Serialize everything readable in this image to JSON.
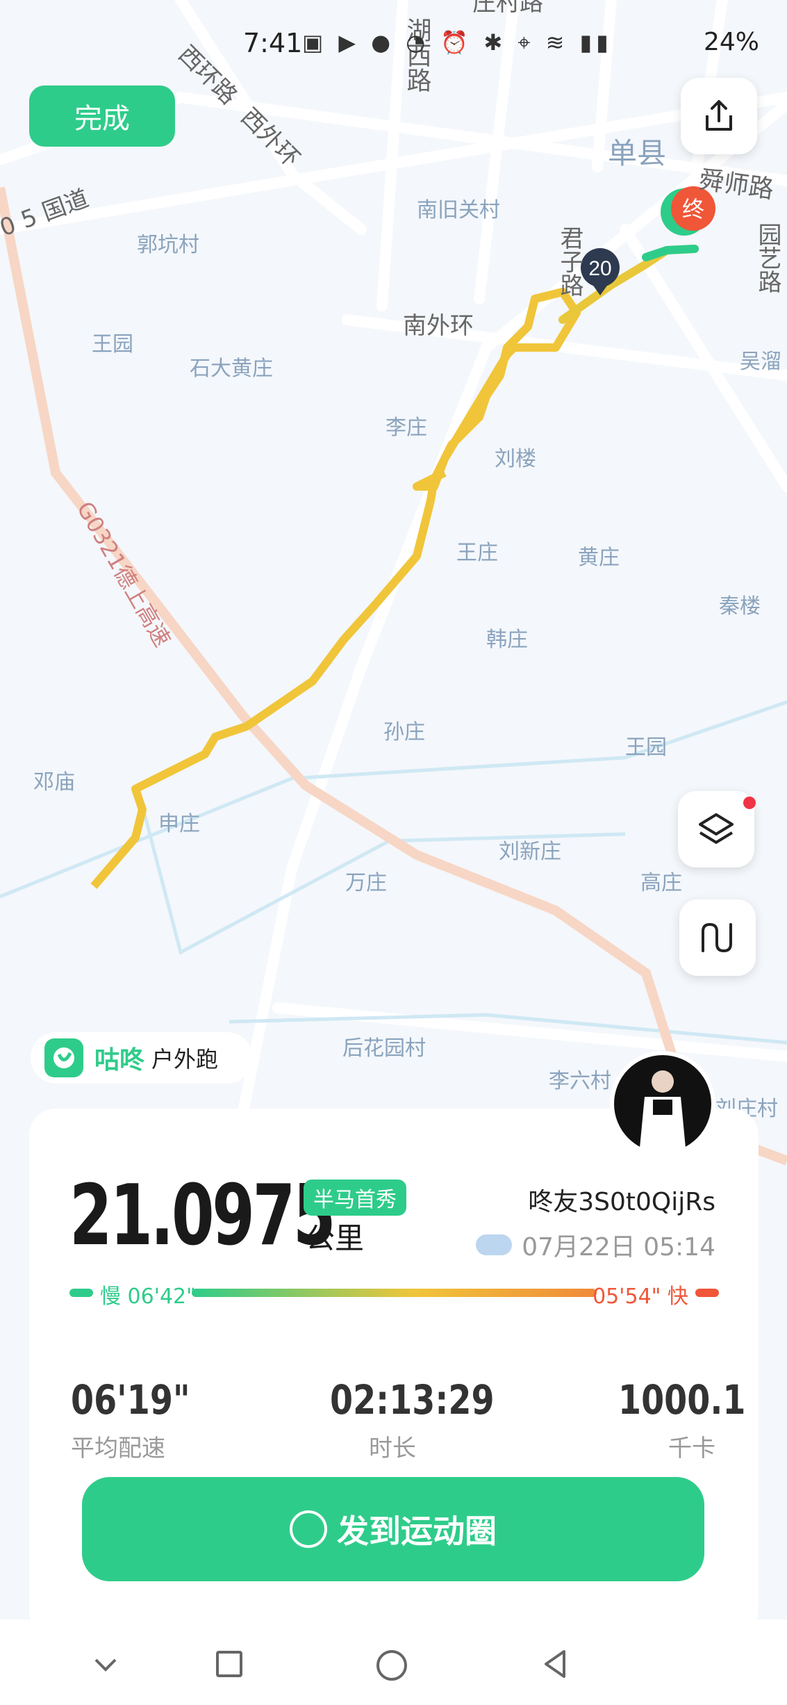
{
  "status_bar": {
    "time": "7:41",
    "battery": "24%"
  },
  "map": {
    "labels": [
      {
        "id": "xihuan-lu",
        "text": "西环路"
      },
      {
        "id": "xiwaihuan",
        "text": "西外环"
      },
      {
        "id": "hu-xi-lu",
        "text": "湖西路"
      },
      {
        "id": "zhuang-li-lu",
        "text": "庄村路"
      },
      {
        "id": "guodao",
        "text": "0 5 国道"
      },
      {
        "id": "danxian",
        "text": "单县"
      },
      {
        "id": "shunshi-lu",
        "text": "舜师路"
      },
      {
        "id": "nanjiuguan",
        "text": "南旧关村"
      },
      {
        "id": "guokeng",
        "text": "郭坑村"
      },
      {
        "id": "junzi-lu",
        "text": "君子路"
      },
      {
        "id": "yuanyi-lu",
        "text": "园艺路"
      },
      {
        "id": "wangyuan",
        "text": "王园"
      },
      {
        "id": "shidahuang",
        "text": "石大黄庄"
      },
      {
        "id": "nanwaihuan",
        "text": "南外环"
      },
      {
        "id": "wuliu",
        "text": "吴溜"
      },
      {
        "id": "lizhuang",
        "text": "李庄"
      },
      {
        "id": "liulou",
        "text": "刘楼"
      },
      {
        "id": "wangzhuang",
        "text": "王庄"
      },
      {
        "id": "huangzhuang",
        "text": "黄庄"
      },
      {
        "id": "qinlou",
        "text": "秦楼"
      },
      {
        "id": "g0321",
        "text": "G0321德上高速"
      },
      {
        "id": "hanzhuang",
        "text": "韩庄"
      },
      {
        "id": "sunzhuang",
        "text": "孙庄"
      },
      {
        "id": "wangyuan2",
        "text": "王园"
      },
      {
        "id": "dengmiao",
        "text": "邓庙"
      },
      {
        "id": "shenzhuang",
        "text": "申庄"
      },
      {
        "id": "liuxinzhuang",
        "text": "刘新庄"
      },
      {
        "id": "wanzhuang",
        "text": "万庄"
      },
      {
        "id": "gaozhuang",
        "text": "高庄"
      },
      {
        "id": "houhuayuan",
        "text": "后花园村"
      },
      {
        "id": "liliuzhuang",
        "text": "李六村"
      },
      {
        "id": "liuzhuangcun",
        "text": "刘庄村"
      }
    ],
    "km_marker": "20",
    "end_marker": "终"
  },
  "header": {
    "done_label": "完成"
  },
  "brand": {
    "name": "咕咚",
    "activity": "户外跑"
  },
  "summary": {
    "distance": "21.0975",
    "badge": "半马首秀",
    "unit": "公里",
    "username": "咚友3S0t0QijRs",
    "datetime": "07月22日 05:14",
    "pace_slow": "慢 06'42\"",
    "pace_fast": "05'54\" 快",
    "stats": [
      {
        "value": "06'19\"",
        "label": "平均配速"
      },
      {
        "value": "02:13:29",
        "label": "时长"
      },
      {
        "value": "1000.1",
        "label": "千卡"
      }
    ]
  },
  "actions": {
    "post_label": "发到运动圈"
  },
  "colors": {
    "accent": "#2ecc8a",
    "route": "#f0c53a",
    "fast": "#f05638"
  }
}
